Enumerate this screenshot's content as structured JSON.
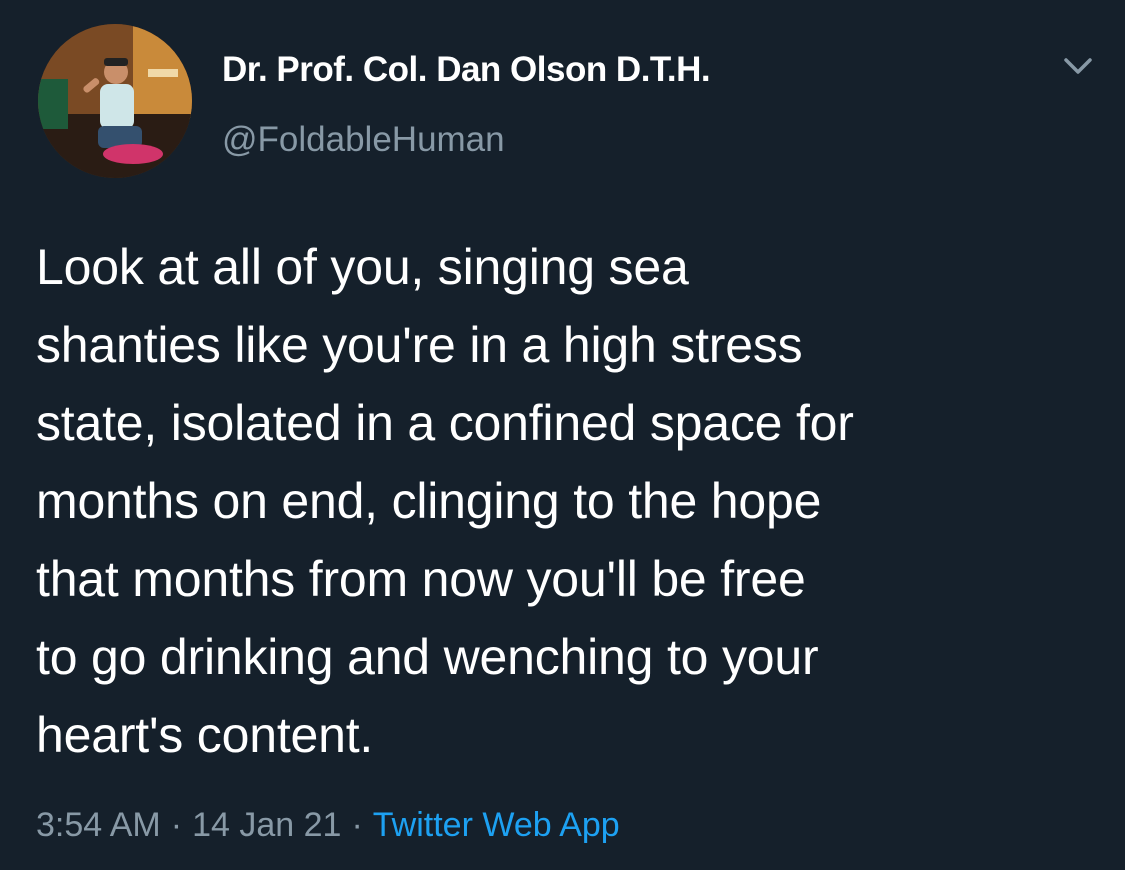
{
  "tweet": {
    "author": {
      "display_name": "Dr. Prof. Col. Dan Olson D.T.H.",
      "handle": "@FoldableHuman",
      "avatar_icon": "profile-photo"
    },
    "menu_icon": "chevron-down-icon",
    "text": "Look at all of you, singing sea\nshanties like you're in a high stress\nstate, isolated in a confined space for\nmonths on end, clinging to the hope\nthat months from now you'll be free\nto go drinking and wenching to your\nheart's content.",
    "time": "3:54 AM",
    "date": "14 Jan 21",
    "separator": "·",
    "source": "Twitter Web App"
  },
  "colors": {
    "background": "#15202b",
    "text": "#ffffff",
    "secondary_text": "#8899a6",
    "link": "#1da1f2"
  }
}
